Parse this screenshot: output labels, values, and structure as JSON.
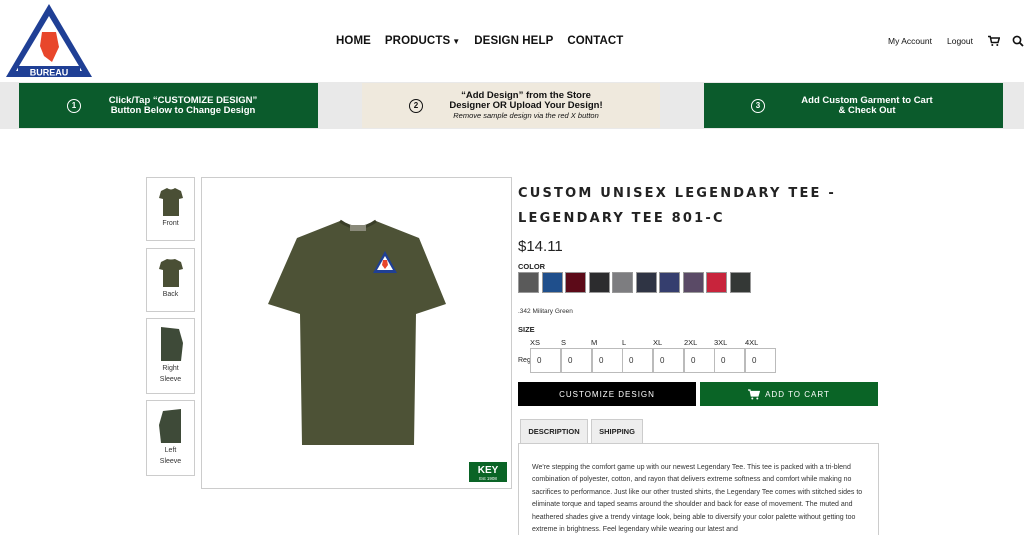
{
  "logo": {
    "top_text": "FLORIDA FARM",
    "bottom_text": "BUREAU",
    "small_text": "VOICE OF AGRICULTURE"
  },
  "nav": {
    "items": [
      {
        "label": "HOME"
      },
      {
        "label": "PRODUCTS"
      },
      {
        "label": "DESIGN HELP"
      },
      {
        "label": "CONTACT"
      }
    ]
  },
  "utility": {
    "account": "My Account",
    "logout": "Logout",
    "cart_icon": "cart-icon",
    "search_icon": "search-icon"
  },
  "steps": [
    {
      "num": "1",
      "line1": "Click/Tap “CUSTOMIZE DESIGN”",
      "line2": "Button Below to Change Design",
      "sub": ""
    },
    {
      "num": "2",
      "line1": "“Add Design” from the Store",
      "line2": "Designer OR Upload Your Design!",
      "sub": "Remove sample design via the red X button"
    },
    {
      "num": "3",
      "line1": "Add Custom Garment to Cart",
      "line2": "& Check Out",
      "sub": ""
    }
  ],
  "thumbnails": [
    {
      "label1": "Front",
      "label2": ""
    },
    {
      "label1": "Back",
      "label2": ""
    },
    {
      "label1": "Right",
      "label2": "Sleeve"
    },
    {
      "label1": "Left",
      "label2": "Sleeve"
    }
  ],
  "key_logo": {
    "text": "KEY",
    "sub": "Est 1908"
  },
  "product": {
    "title": "CUSTOM UNISEX LEGENDARY TEE - LEGENDARY TEE 801-C",
    "price": "$14.11",
    "color_label": "COLOR",
    "colors": [
      "#5a5a5a",
      "#1f4f8c",
      "#5c0a18",
      "#2c2c2e",
      "#7d7d80",
      "#2f3444",
      "#353e6e",
      "#5a4a66",
      "#c8243c",
      "#343836"
    ],
    "selected_color": ".342 Military Green",
    "size_label": "SIZE",
    "sizes": [
      "XS",
      "S",
      "M",
      "L",
      "XL",
      "2XL",
      "3XL",
      "4XL"
    ],
    "row_label": "Reg",
    "quantities": [
      "0",
      "0",
      "0",
      "0",
      "0",
      "0",
      "0",
      "0"
    ],
    "customize_label": "CUSTOMIZE DESIGN",
    "add_to_cart_label": "ADD TO CART",
    "tabs": [
      {
        "label": "DESCRIPTION"
      },
      {
        "label": "SHIPPING"
      }
    ],
    "description": "We're stepping the comfort game up with our newest Legendary Tee. This tee is packed with a tri-blend combination of polyester, cotton, and rayon that delivers extreme softness and comfort while making no sacrifices to performance. Just like our other trusted shirts, the Legendary Tee comes with stitched sides to eliminate torque and taped seams around the shoulder and back for ease of movement. The muted and heathered shades give a trendy vintage look, being able to diversify your color palette without getting too extreme in brightness. Feel legendary while wearing our latest and"
  }
}
